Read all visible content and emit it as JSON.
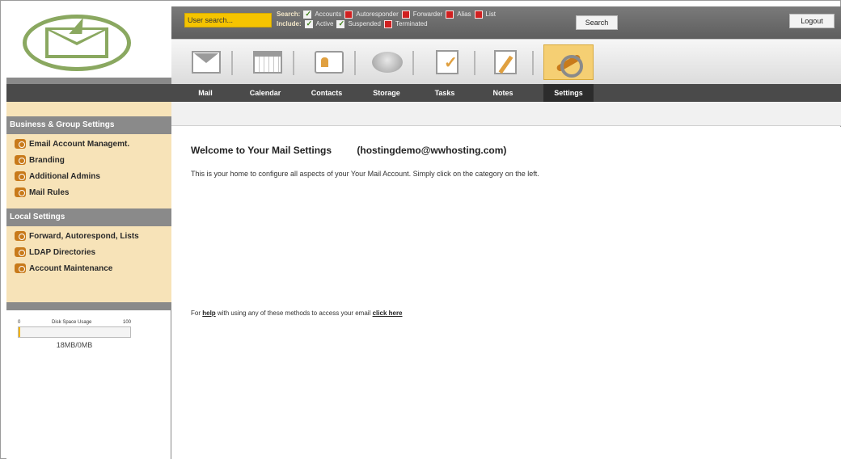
{
  "top_bar": {
    "user_search_placeholder": "User search...",
    "search_label": "Search:",
    "include_label": "Include:",
    "search_options": [
      {
        "label": "Accounts",
        "checked": true
      },
      {
        "label": "Autoresponder",
        "checked": false
      },
      {
        "label": "Forwarder",
        "checked": false
      },
      {
        "label": "Alias",
        "checked": false
      },
      {
        "label": "List",
        "checked": false
      }
    ],
    "include_options": [
      {
        "label": "Active",
        "checked": true
      },
      {
        "label": "Suspended",
        "checked": true
      },
      {
        "label": "Terminated",
        "checked": false
      }
    ],
    "search_button": "Search",
    "logout_button": "Logout"
  },
  "nav": {
    "tabs": [
      "Mail",
      "Calendar",
      "Contacts",
      "Storage",
      "Tasks",
      "Notes",
      "Settings"
    ],
    "active_tab": "Settings",
    "icons": [
      "mail-icon",
      "calendar-icon",
      "contacts-icon",
      "storage-icon",
      "tasks-icon",
      "notes-icon",
      "settings-icon"
    ]
  },
  "sidebar": {
    "sections": [
      {
        "title": "Business & Group Settings",
        "items": [
          "Email Account Managemt.",
          "Branding",
          "Additional Admins",
          "Mail Rules"
        ]
      },
      {
        "title": "Local Settings",
        "items": [
          "Forward, Autorespond, Lists",
          "LDAP Directories",
          "Account Maintenance"
        ]
      }
    ],
    "disk": {
      "label": "Disk Space Usage",
      "min": "0",
      "max": "100",
      "usage_text": "18MB/0MB",
      "fill_fraction": 0.01
    }
  },
  "main": {
    "welcome_title": "Welcome to Your Mail Settings",
    "account": "(hostingdemo@wwhosting.com)",
    "intro": "This is your home to configure all aspects of your Your Mail Account. Simply click on the category on the left.",
    "help_prefix": "For",
    "help_link": "help",
    "help_middle": "with using any of these methods to access your email",
    "click_here": "click here"
  },
  "colors": {
    "accent_yellow": "#f5c400",
    "sidebar_bg": "#f7e3b8",
    "logo_green": "#8aa860",
    "nav_dark": "#4a4a4a"
  }
}
